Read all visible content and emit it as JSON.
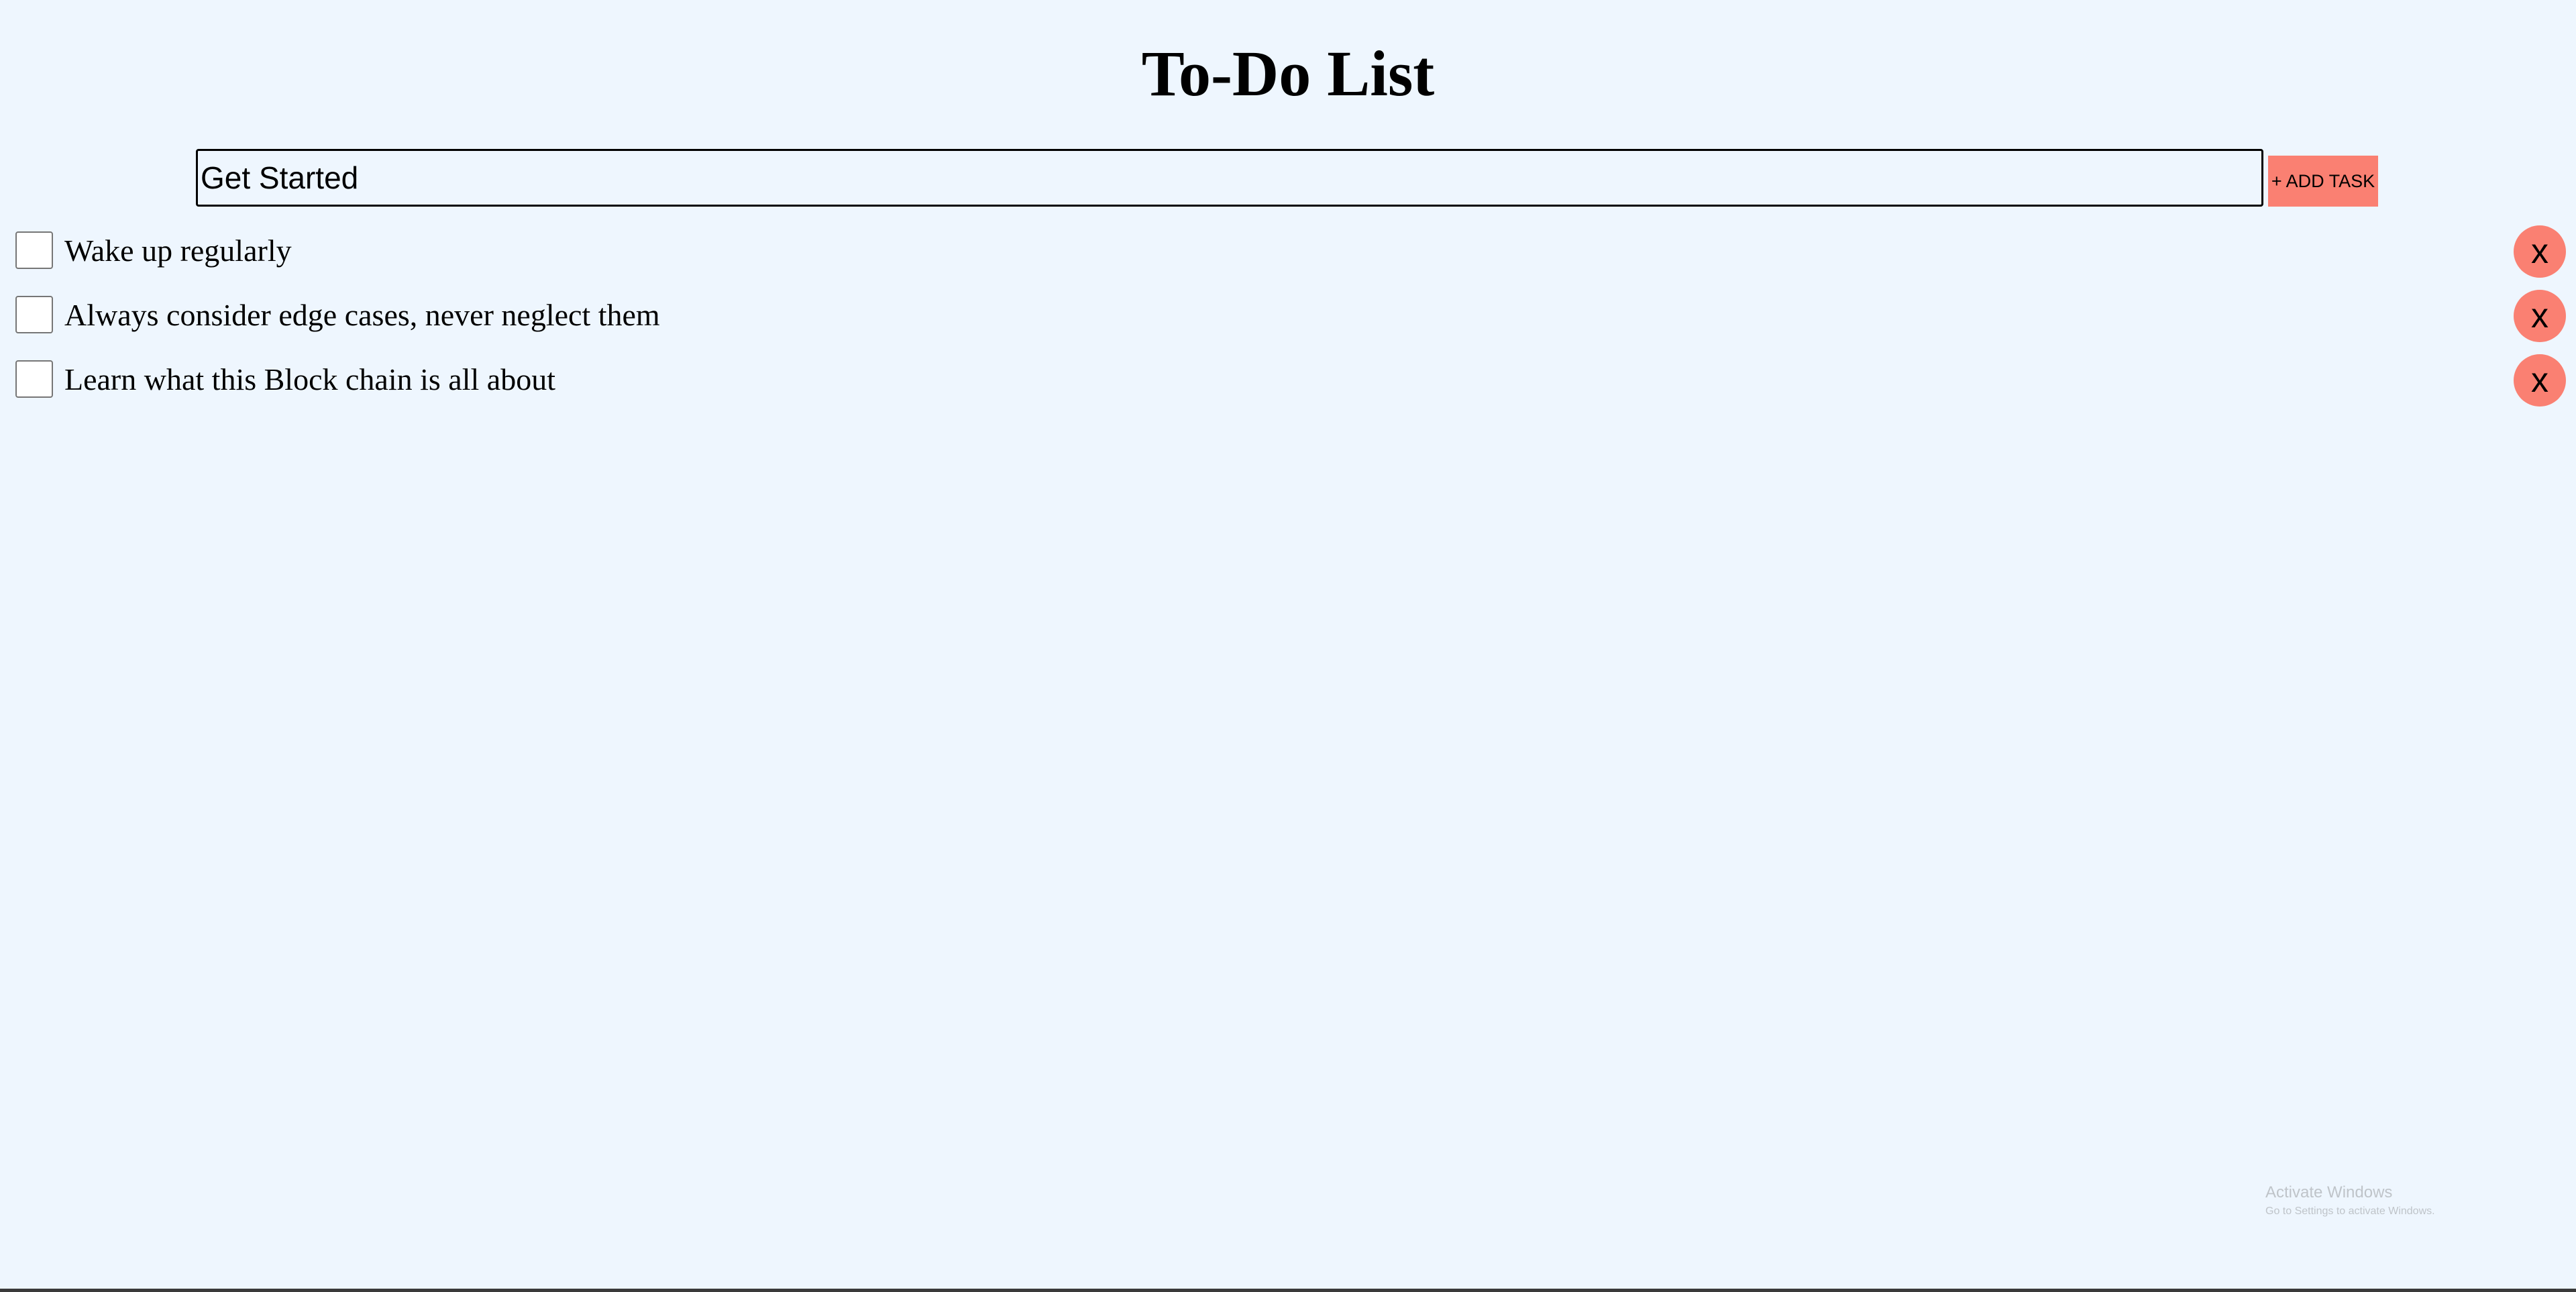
{
  "page": {
    "title": "To-Do List"
  },
  "task_input": {
    "value": "Get Started",
    "placeholder": ""
  },
  "add_button": {
    "label": "+ ADD TASK"
  },
  "tasks": [
    {
      "text": "Wake up regularly",
      "checked": false,
      "delete_label": "x"
    },
    {
      "text": "Always consider edge cases, never neglect them",
      "checked": false,
      "delete_label": "x"
    },
    {
      "text": "Learn what this Block chain is all about",
      "checked": false,
      "delete_label": "x"
    }
  ],
  "watermark": {
    "title": "Activate Windows",
    "subtitle": "Go to Settings to activate Windows."
  },
  "colors": {
    "background": "#eef6fe",
    "accent": "#fa8072",
    "text": "#000000"
  }
}
